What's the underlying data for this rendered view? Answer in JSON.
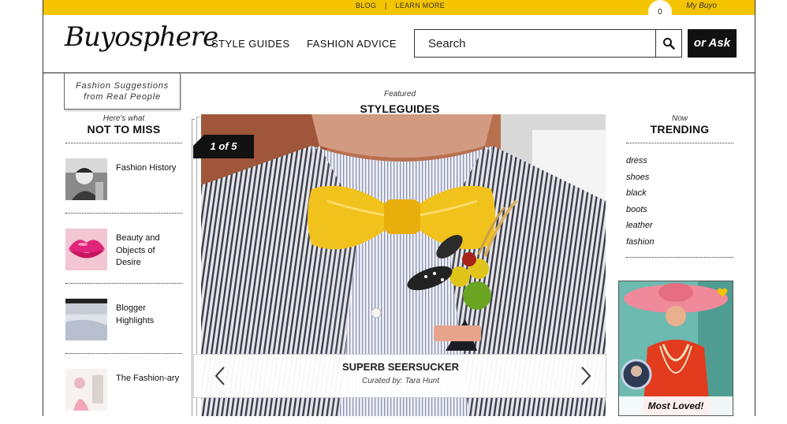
{
  "topbar": {
    "links": [
      "BLOG",
      "|",
      "LEARN MORE"
    ],
    "cart_count": "0",
    "account_label": "My Buyo"
  },
  "header": {
    "logo_text": "Buyosphere",
    "nav": [
      "STYLE GUIDES",
      "FASHION ADVICE"
    ],
    "search_placeholder": "Search",
    "ask_label": "or Ask",
    "tagline_line1": "Fashion Suggestions",
    "tagline_line2": "from Real People"
  },
  "left": {
    "subtitle": "Here's what",
    "title": "NOT TO MISS",
    "items": [
      {
        "label": "Fashion History"
      },
      {
        "label": "Beauty and Objects of Desire"
      },
      {
        "label": "Blogger Highlights"
      },
      {
        "label": "The Fashion-ary"
      }
    ]
  },
  "featured": {
    "subtitle": "Featured",
    "title": "STYLEGUIDES",
    "pager": "1 of 5",
    "slide_title": "SUPERB SEERSUCKER",
    "slide_byline": "Curated by: Tara Hunt"
  },
  "trending": {
    "subtitle": "Now",
    "title": "TRENDING",
    "tags": [
      "dress",
      "shoes",
      "black",
      "boots",
      "leather",
      "fashion"
    ],
    "loved_label": "Most Loved!"
  },
  "colors": {
    "accent_yellow": "#f5c400",
    "dark": "#111111"
  },
  "icons": [
    "search-icon",
    "chevron-left-icon",
    "chevron-right-icon",
    "heart-icon"
  ]
}
